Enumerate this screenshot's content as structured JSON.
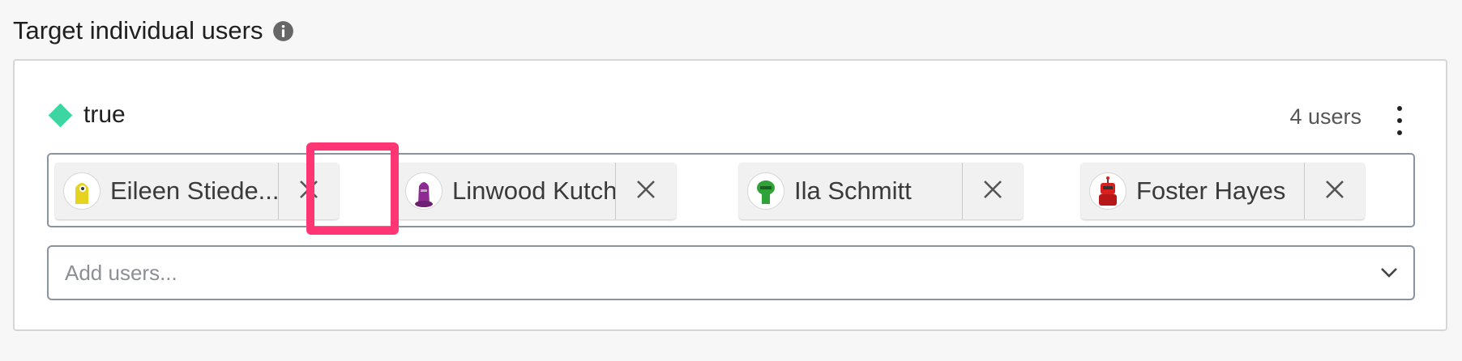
{
  "section": {
    "title": "Target individual users",
    "info_icon": "info-icon"
  },
  "variation": {
    "label": "true",
    "color": "#3dd6a3",
    "user_count": "4 users",
    "menu_icon": "kebab-menu-icon"
  },
  "chips": [
    {
      "name": "Eileen Stiede...",
      "avatar_color": "#e5d31f",
      "remove_icon": "close-icon"
    },
    {
      "name": "Linwood Kutch",
      "avatar_color": "#8e2b93",
      "remove_icon": "close-icon"
    },
    {
      "name": "Ila Schmitt",
      "avatar_color": "#2fa33a",
      "remove_icon": "close-icon"
    },
    {
      "name": "Foster Hayes",
      "avatar_color": "#d91f1f",
      "remove_icon": "close-icon"
    }
  ],
  "add_users": {
    "placeholder": "Add users...",
    "icon": "chevron-down-icon"
  },
  "colors": {
    "highlight": "#ff3574",
    "page_background": "#f7f7f7"
  }
}
